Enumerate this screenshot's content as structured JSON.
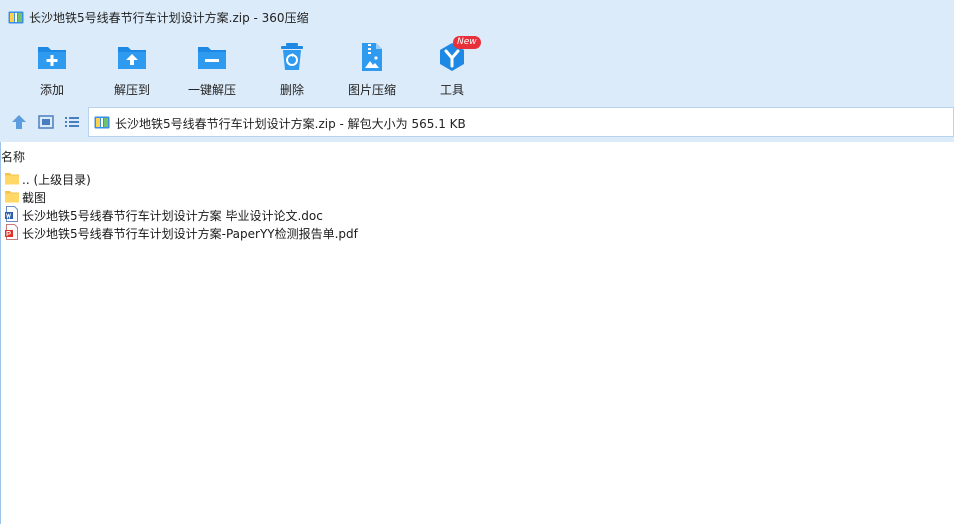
{
  "window": {
    "title": "长沙地铁5号线春节行车计划设计方案.zip - 360压缩"
  },
  "toolbar": {
    "buttons": [
      {
        "label": "添加",
        "icon": "add-folder-icon"
      },
      {
        "label": "解压到",
        "icon": "extract-to-icon"
      },
      {
        "label": "一键解压",
        "icon": "one-click-extract-icon"
      },
      {
        "label": "删除",
        "icon": "recycle-bin-icon"
      },
      {
        "label": "图片压缩",
        "icon": "image-compress-icon"
      },
      {
        "label": "工具",
        "icon": "tools-icon",
        "badge": "New"
      }
    ]
  },
  "nav": {
    "address": "长沙地铁5号线春节行车计划设计方案.zip - 解包大小为 565.1 KB"
  },
  "filelist": {
    "column_header": "名称",
    "items": [
      {
        "name": ".. (上级目录)",
        "type": "folder"
      },
      {
        "name": "截图",
        "type": "folder"
      },
      {
        "name": "长沙地铁5号线春节行车计划设计方案 毕业设计论文.doc",
        "type": "doc"
      },
      {
        "name": "长沙地铁5号线春节行车计划设计方案-PaperYY检测报告单.pdf",
        "type": "pdf"
      }
    ]
  },
  "colors": {
    "chrome_background": "#dcebf9",
    "accent_blue": "#1e88e5",
    "badge_red": "#e8303a",
    "folder_yellow": "#ffd866"
  }
}
